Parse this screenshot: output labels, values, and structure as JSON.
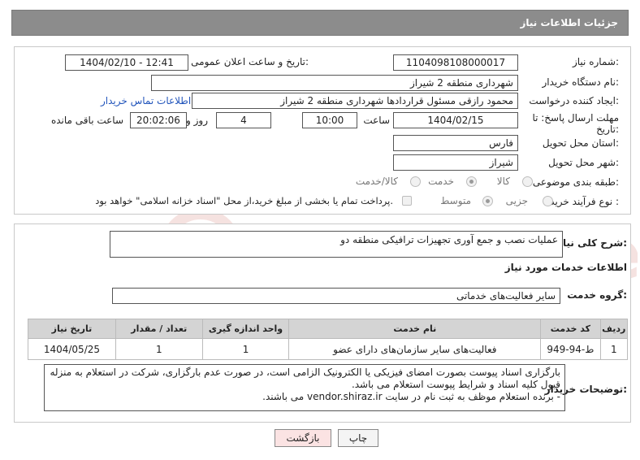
{
  "header": {
    "title": "جزئیات اطلاعات نیاز"
  },
  "form": {
    "need_number_label": "شماره نیاز:",
    "need_number": "1104098108000017",
    "announce_label": "تاریخ و ساعت اعلان عمومی:",
    "announce_value": "1404/02/10 - 12:41",
    "buyer_org_label": "نام دستگاه خریدار:",
    "buyer_org": "شهرداری منطقه 2 شیراز",
    "requester_label": "ایجاد کننده درخواست:",
    "requester": "محمود رازقی مسئول قراردادها شهرداری منطقه 2 شیراز",
    "contact_link": "اطلاعات تماس خریدار",
    "deadline_label_1": "مهلت ارسال پاسخ: تا",
    "deadline_label_2": "تاریخ:",
    "deadline_date": "1404/02/15",
    "time_label": "ساعت",
    "deadline_time": "10:00",
    "days_value": "4",
    "days_label": "روز و",
    "remaining_value": "20:02:06",
    "remaining_label": "ساعت باقی مانده",
    "province_label": "استان محل تحویل:",
    "province": "فارس",
    "city_label": "شهر محل تحویل:",
    "city": "شیراز",
    "category_label": "طبقه بندی موضوعی:",
    "category_options": [
      "کالا",
      "خدمت",
      "کالا/خدمت"
    ],
    "category_selected": "خدمت",
    "process_label": "نوع فرآیند خرید :",
    "process_options": [
      "جزیی",
      "متوسط"
    ],
    "process_selected": "متوسط",
    "payment_note": "پرداخت تمام یا بخشی از مبلغ خرید،از محل \"اسناد خزانه اسلامی\" خواهد بود."
  },
  "details": {
    "summary_label": "شرح کلی نیاز:",
    "summary": "عملیات نصب و جمع آوری تجهیزات ترافیکی منطقه دو",
    "services_title": "اطلاعات خدمات مورد نیاز",
    "service_group_label": "گروه خدمت:",
    "service_group": "سایر فعالیت‌های خدماتی",
    "table": {
      "headers": [
        "ردیف",
        "کد خدمت",
        "نام خدمت",
        "واحد اندازه گیری",
        "تعداد / مقدار",
        "تاریخ نیاز"
      ],
      "rows": [
        [
          "1",
          "ط-94-949",
          "فعالیت‌های سایر سازمان‌های دارای عضو",
          "1",
          "1",
          "1404/05/25"
        ]
      ]
    },
    "notes_label": "توضیحات خریدار:",
    "notes_line1": "بارگزاری اسناد پیوست بصورت امضای فیزیکی یا الکترونیک الزامی است، در صورت عدم بارگزاری، شرکت در استعلام به منزله",
    "notes_line2": "قبول کلیه اسناد و شرایط پیوست استعلام می باشد.",
    "notes_line3": "- برنده استعلام موظف به ثبت نام در سایت vendor.shiraz.ir می باشند."
  },
  "buttons": {
    "print": "چاپ",
    "back": "بازگشت"
  },
  "watermark": {
    "text": "AriaTender.neT"
  },
  "colors": {
    "header_bg": "#8c8c8c",
    "link": "#2255bb",
    "table_header_bg": "#d4d4d4",
    "back_button_bg": "#fbe3e3",
    "watermark": "#c0392b"
  }
}
